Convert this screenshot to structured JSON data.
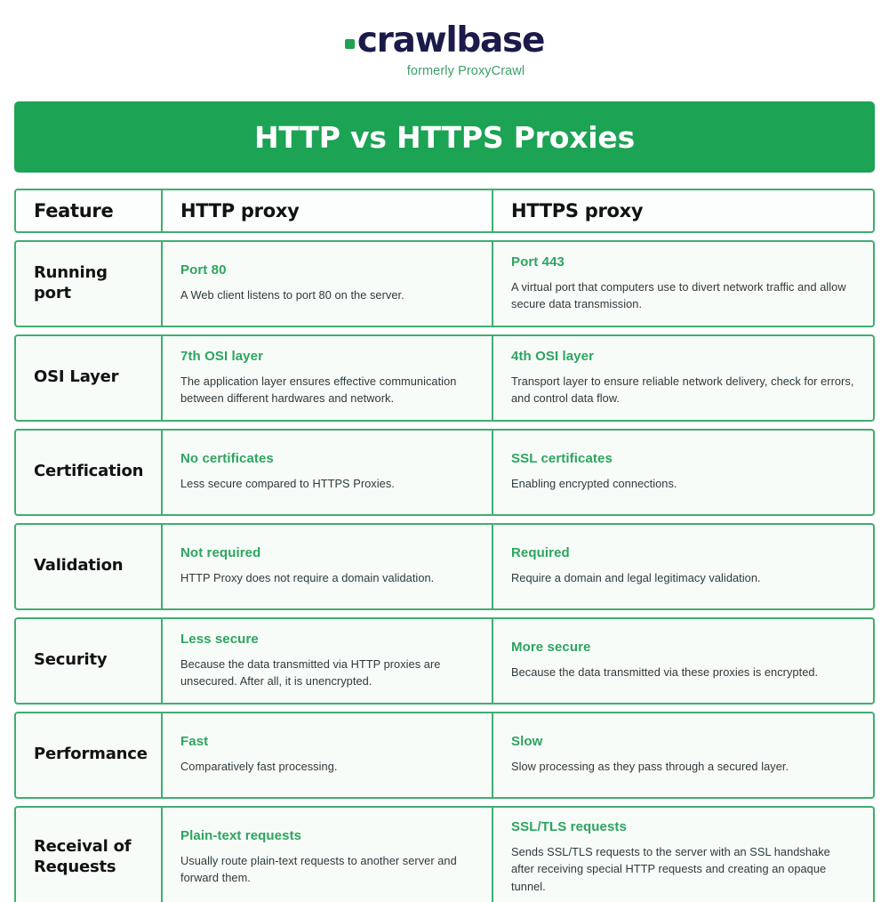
{
  "logo": {
    "wordmark": "crawlbase",
    "tagline": "formerly ProxyCrawl",
    "dot_color": "#1CA354",
    "wordmark_color": "#1B1B4B",
    "tagline_color": "#3FA06A"
  },
  "banner": {
    "title": "HTTP vs HTTPS Proxies",
    "background": "#1CA354",
    "text_color": "#FFFFFF"
  },
  "theme": {
    "border_green": "#3FAE70",
    "accent_green": "#2DA45F",
    "cell_background": "#F7FCF9",
    "body_text": "#2E3A3A",
    "heading_text": "#121212"
  },
  "table": {
    "columns": [
      {
        "key": "feature",
        "label": "Feature"
      },
      {
        "key": "http",
        "label": "HTTP proxy"
      },
      {
        "key": "https",
        "label": "HTTPS proxy"
      }
    ],
    "rows": [
      {
        "feature": "Running port",
        "http": {
          "accent": "Port 80",
          "desc": "A Web client listens to port 80 on the server."
        },
        "https": {
          "accent": "Port 443",
          "desc": "A virtual port that computers use to divert network traffic and allow secure data transmission."
        }
      },
      {
        "feature": "OSI Layer",
        "http": {
          "accent": "7th OSI layer",
          "desc": "The application layer ensures effective communication between different hardwares and network."
        },
        "https": {
          "accent": "4th OSI layer",
          "desc": "Transport layer to ensure reliable network delivery, check for errors, and control data flow."
        }
      },
      {
        "feature": "Certification",
        "http": {
          "accent": "No certificates",
          "desc": "Less secure compared to HTTPS Proxies."
        },
        "https": {
          "accent": "SSL certificates",
          "desc": "Enabling encrypted connections."
        }
      },
      {
        "feature": "Validation",
        "http": {
          "accent": "Not required",
          "desc": "HTTP Proxy does not require a domain validation."
        },
        "https": {
          "accent": "Required",
          "desc": "Require a domain and legal legitimacy validation."
        }
      },
      {
        "feature": "Security",
        "http": {
          "accent": "Less secure",
          "desc": "Because the data transmitted via HTTP proxies are unsecured. After all, it is unencrypted."
        },
        "https": {
          "accent": "More secure",
          "desc": "Because the data transmitted via these proxies is encrypted."
        }
      },
      {
        "feature": "Performance",
        "http": {
          "accent": "Fast",
          "desc": "Comparatively fast processing."
        },
        "https": {
          "accent": "Slow",
          "desc": "Slow processing as they pass through a secured layer."
        }
      },
      {
        "feature": "Receival of Requests",
        "http": {
          "accent": "Plain-text requests",
          "desc": "Usually route plain-text requests to another server and forward them."
        },
        "https": {
          "accent": "SSL/TLS requests",
          "desc": "Sends SSL/TLS requests to the server with an SSL handshake after receiving special HTTP requests and creating an opaque tunnel."
        }
      }
    ]
  }
}
